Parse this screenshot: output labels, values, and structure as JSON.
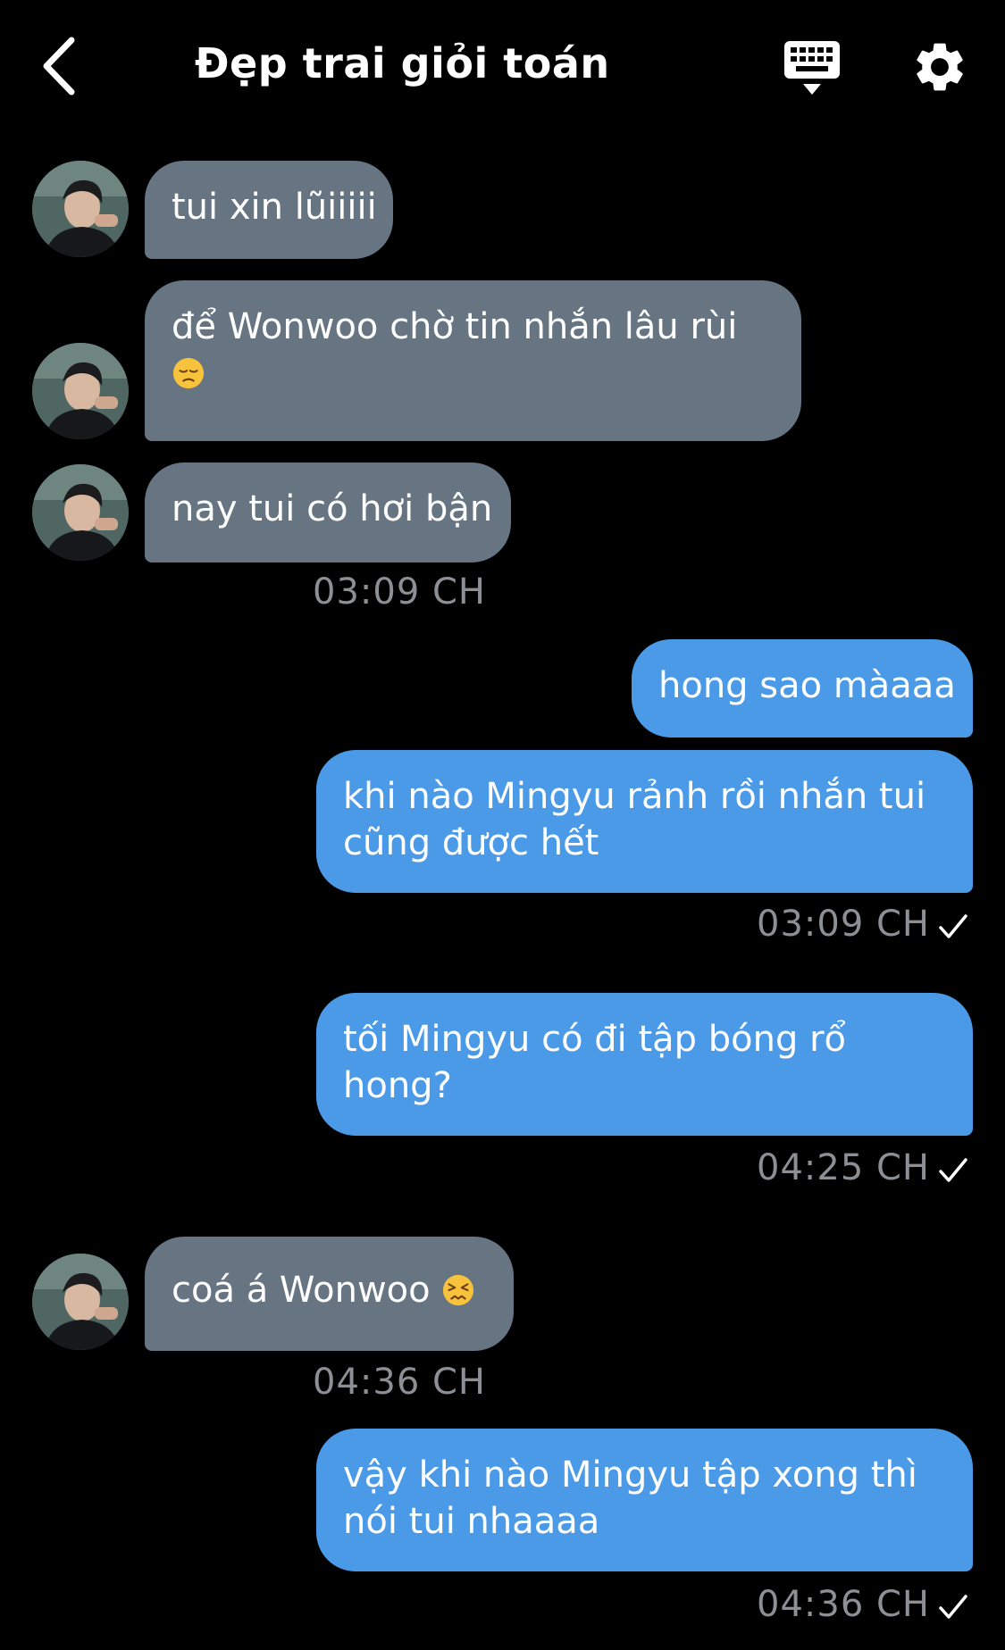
{
  "header": {
    "title": "Đẹp trai giỏi toán",
    "back_icon": "chevron-left-icon",
    "keyboard_icon": "keyboard-icon",
    "settings_icon": "gear-icon"
  },
  "messages": [
    {
      "dir": "in",
      "lines": [
        "tui xin lũiiiii"
      ]
    },
    {
      "dir": "in",
      "lines": [
        "để Wonwoo chờ tin nhắn lâu rùi"
      ],
      "emoji": "pensive-face"
    },
    {
      "dir": "in",
      "lines": [
        "nay tui có hơi bận"
      ]
    },
    {
      "time": "03:09 CH"
    },
    {
      "dir": "out",
      "lines": [
        "hong sao màaaa"
      ]
    },
    {
      "dir": "out",
      "lines": [
        "khi nào Mingyu rảnh rồi nhắn tui",
        "cũng được hết"
      ]
    },
    {
      "time": "03:09 CH",
      "read": true
    },
    {
      "dir": "out",
      "lines": [
        "tối Mingyu có đi tập bóng rổ",
        "hong?"
      ]
    },
    {
      "time": "04:25 CH",
      "read": true
    },
    {
      "dir": "in",
      "lines": [
        "coá á Wonwoo"
      ],
      "emoji": "persevering-face"
    },
    {
      "time": "04:36 CH"
    },
    {
      "dir": "out",
      "lines": [
        "vậy khi nào Mingyu tập xong thì",
        "nói tui nhaaaa"
      ]
    },
    {
      "time": "04:36 CH",
      "read": true
    }
  ],
  "colors": {
    "background": "#000000",
    "incoming_bubble": "#677482",
    "outgoing_bubble": "#4a9ae8",
    "timestamp": "#8c8f94"
  }
}
